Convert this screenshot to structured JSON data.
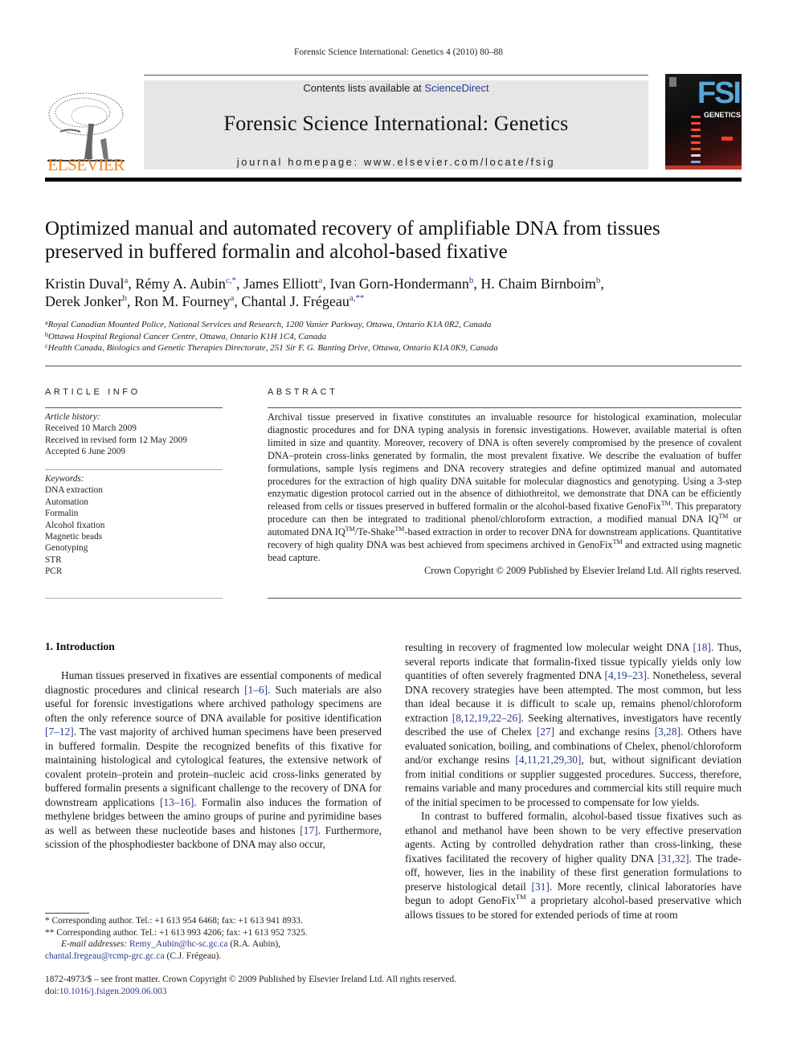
{
  "running_header": "Forensic Science International: Genetics 4 (2010) 80–88",
  "masthead": {
    "contents_prefix": "Contents lists available at ",
    "contents_link": "ScienceDirect",
    "journal_name": "Forensic Science International: Genetics",
    "homepage": "journal homepage: www.elsevier.com/locate/fsig",
    "publisher_logo_text": "ELSEVIER",
    "cover": {
      "big_text": "FSI",
      "sub_text": "GENETICS"
    }
  },
  "colors": {
    "link": "#2a3b8f",
    "elsevier_orange": "#f0821e",
    "masthead_bg": "#e6e6e6"
  },
  "title_lines": [
    "Optimized manual and automated recovery of amplifiable DNA from tissues",
    "preserved in buffered formalin and alcohol-based fixative"
  ],
  "authors": [
    {
      "name": "Kristin Duval",
      "sup": "a",
      "sep": ", "
    },
    {
      "name": "Rémy A. Aubin",
      "sup": "c,*",
      "sep": ", "
    },
    {
      "name": "James Elliott",
      "sup": "a",
      "sep": ", "
    },
    {
      "name": "Ivan Gorn-Hondermann",
      "sup": "b",
      "sep": ", "
    },
    {
      "name": "H. Chaim Birnboim",
      "sup": "b",
      "sep": ","
    },
    {
      "name": "Derek Jonker",
      "sup": "b",
      "sep": ", "
    },
    {
      "name": "Ron M. Fourney",
      "sup": "a",
      "sep": ", "
    },
    {
      "name": "Chantal J. Frégeau",
      "sup": "a,**",
      "sep": ""
    }
  ],
  "affiliations": [
    {
      "key": "a",
      "text": "Royal Canadian Mounted Police, National Services and Research, 1200 Vanier Parkway, Ottawa, Ontario K1A 0R2, Canada"
    },
    {
      "key": "b",
      "text": "Ottawa Hospital Regional Cancer Centre, Ottawa, Ontario K1H 1C4, Canada"
    },
    {
      "key": "c",
      "text": "Health Canada, Biologics and Genetic Therapies Directorate, 251 Sir F. G. Banting Drive, Ottawa, Ontario K1A 0K9, Canada"
    }
  ],
  "article_info": {
    "label": "ARTICLE INFO",
    "history_heading": "Article history:",
    "history": [
      "Received 10 March 2009",
      "Received in revised form 12 May 2009",
      "Accepted 6 June 2009"
    ],
    "keywords_heading": "Keywords:",
    "keywords": [
      "DNA extraction",
      "Automation",
      "Formalin",
      "Alcohol fixation",
      "Magnetic beads",
      "Genotyping",
      "STR",
      "PCR"
    ]
  },
  "abstract": {
    "label": "ABSTRACT",
    "p1": "Archival tissue preserved in fixative constitutes an invaluable resource for histological examination, molecular diagnostic procedures and for DNA typing analysis in forensic investigations. However, available material is often limited in size and quantity. Moreover, recovery of DNA is often severely compromised by the presence of covalent DNA–protein cross-links generated by formalin, the most prevalent fixative. We describe the evaluation of buffer formulations, sample lysis regimens and DNA recovery strategies and define optimized manual and automated procedures for the extraction of high quality DNA suitable for molecular diagnostics and genotyping. Using a 3-step enzymatic digestion protocol carried out in the absence of dithiothreitol, we demonstrate that DNA can be efficiently released from cells or tissues preserved in buffered formalin or the alcohol-based fixative GenoFix",
    "p2": ". This preparatory procedure can then be integrated to traditional phenol/chloroform extraction, a modified manual DNA IQ",
    "p3": " or automated DNA IQ",
    "p4": "/Te-Shake",
    "p5": "-based extraction in order to recover DNA for downstream applications. Quantitative recovery of high quality DNA was best achieved from specimens archived in GenoFix",
    "p6": " and extracted using magnetic bead capture.",
    "tm": "TM",
    "copyright": "Crown Copyright © 2009 Published by Elsevier Ireland Ltd. All rights reserved."
  },
  "intro": {
    "heading": "1.  Introduction",
    "left": {
      "t1": "Human tissues preserved in fixatives are essential components of medical diagnostic procedures and clinical research ",
      "r1": "[1–6]",
      "t2": ". Such materials are also useful for forensic investigations where archived pathology specimens are often the only reference source of DNA available for positive identification ",
      "r2": "[7–12]",
      "t3": ". The vast majority of archived human specimens have been preserved in buffered formalin. Despite the recognized benefits of this fixative for maintaining histological and cytological features, the extensive network of covalent protein–protein and protein–nucleic acid cross-links generated by buffered formalin presents a significant challenge to the recovery of DNA for downstream applications ",
      "r3": "[13–16]",
      "t4": ". Formalin also induces the formation of methylene bridges between the amino groups of purine and pyrimidine bases as well as between these nucleotide bases and histones ",
      "r4": "[17]",
      "t5": ". Furthermore, scission of the phosphodiester backbone of DNA may also occur,"
    },
    "right": {
      "t1": "resulting in recovery of fragmented low molecular weight DNA ",
      "r1": "[18]",
      "t2": ". Thus, several reports indicate that formalin-fixed tissue typically yields only low quantities of often severely fragmented DNA ",
      "r2": "[4,19–23]",
      "t3": ". Nonetheless, several DNA recovery strategies have been attempted. The most common, but less than ideal because it is difficult to scale up, remains phenol/chloroform extraction ",
      "r3": "[8,12,19,22–26]",
      "t4": ". Seeking alternatives, investigators have recently described the use of Chelex ",
      "r4": "[27]",
      "t5": " and exchange resins ",
      "r5": "[3,28]",
      "t6": ". Others have evaluated sonication, boiling, and combinations of Chelex, phenol/chloroform and/or exchange resins ",
      "r6": "[4,11,21,29,30]",
      "t7": ", but, without significant deviation from initial conditions or supplier suggested procedures. Success, therefore, remains variable and many procedures and commercial kits still require much of the initial specimen to be processed to compensate for low yields.",
      "p2_t1": "In contrast to buffered formalin, alcohol-based tissue fixatives such as ethanol and methanol have been shown to be very effective preservation agents. Acting by controlled dehydration rather than cross-linking, these fixatives facilitated the recovery of higher quality DNA ",
      "p2_r1": "[31,32]",
      "p2_t2": ". The trade-off, however, lies in the inability of these first generation formulations to preserve histological detail ",
      "p2_r2": "[31]",
      "p2_t3": ". More recently, clinical laboratories have begun to adopt GenoFix",
      "p2_tm": "TM",
      "p2_t4": " a proprietary alcohol-based preservative which allows tissues to be stored for extended periods of time at room"
    }
  },
  "footnotes": {
    "fn1": " *  Corresponding author. Tel.: +1 613 954 6468; fax: +1 613 941 8933.",
    "fn2": "**  Corresponding author. Tel.: +1 613 993 4206; fax: +1 613 952 7325.",
    "email_label": "E-mail addresses:",
    "email1": "Remy_Aubin@hc-sc.gc.ca",
    "email1_who": " (R.A. Aubin),",
    "email2": "chantal.fregeau@rcmp-grc.gc.ca",
    "email2_who": " (C.J. Frégeau)."
  },
  "bottom_meta": {
    "issn_line": "1872-4973/$ – see front matter. Crown Copyright © 2009 Published by Elsevier Ireland Ltd. All rights reserved.",
    "doi_prefix": "doi:",
    "doi": "10.1016/j.fsigen.2009.06.003"
  }
}
